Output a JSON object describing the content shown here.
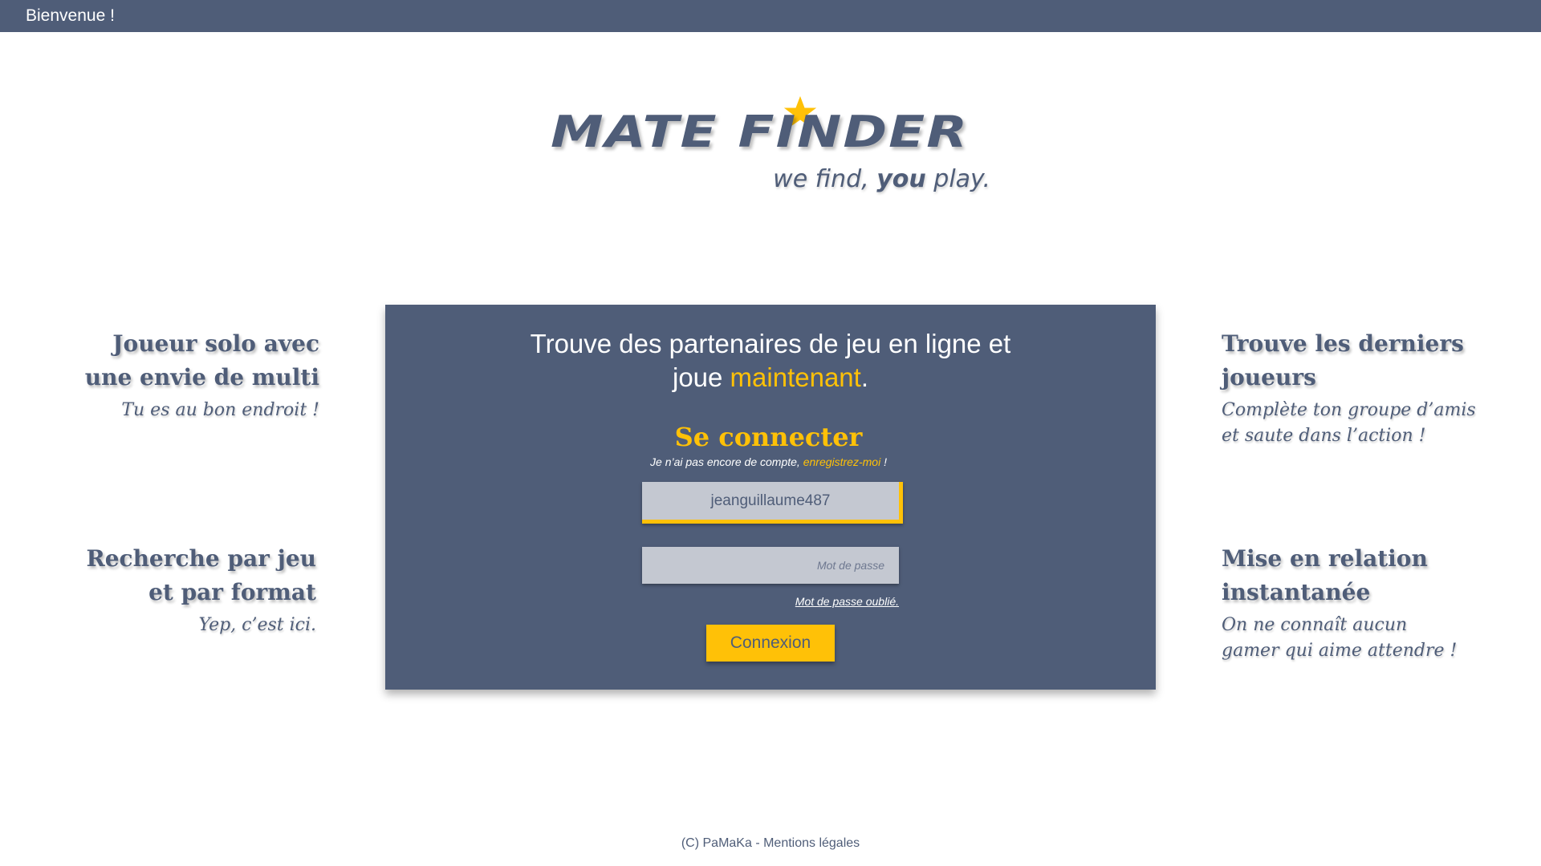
{
  "topbar": {
    "welcome": "Bienvenue !"
  },
  "logo": {
    "wordmark": "MATE FINDER",
    "tagline_before": "we find, ",
    "tagline_emphasis": "you",
    "tagline_after": " play.",
    "star_color": "#ffc107"
  },
  "features": [
    {
      "title_line1": "Joueur solo avec",
      "title_line2": "une envie de multi",
      "text_line1": "Tu es au bon endroit !",
      "text_line2": ""
    },
    {
      "title_line1": "Recherche par jeu",
      "title_line2": "et par format",
      "text_line1": "Yep, c’est ici.",
      "text_line2": ""
    },
    {
      "title_line1": "Trouve les derniers",
      "title_line2": "joueurs",
      "text_line1": "Complète ton groupe d’amis",
      "text_line2": "et saute dans l’action !"
    },
    {
      "title_line1": "Mise en relation",
      "title_line2": "instantanée",
      "text_line1": "On ne connaît aucun",
      "text_line2": "gamer qui aime attendre !"
    }
  ],
  "panel": {
    "headline_line1": "Trouve des partenaires de jeu en ligne et",
    "headline_line2_before": "joue ",
    "headline_highlight": "maintenant",
    "headline_line2_after": ".",
    "login_title": "Se connecter",
    "signup_prefix": "Je n’ai pas encore de compte, ",
    "signup_link": "enregistrez-moi",
    "signup_suffix": " !",
    "username_value": "jeanguillaume487",
    "password_placeholder": "Mot de passe",
    "forgot_label": "Mot de passe oublié.",
    "submit_label": "Connexion"
  },
  "footer": {
    "text": "(C) PaMaKa - Mentions légales"
  },
  "colors": {
    "primary": "#4f5d78",
    "accent": "#ffc107",
    "input_bg": "#c4c8d1"
  }
}
